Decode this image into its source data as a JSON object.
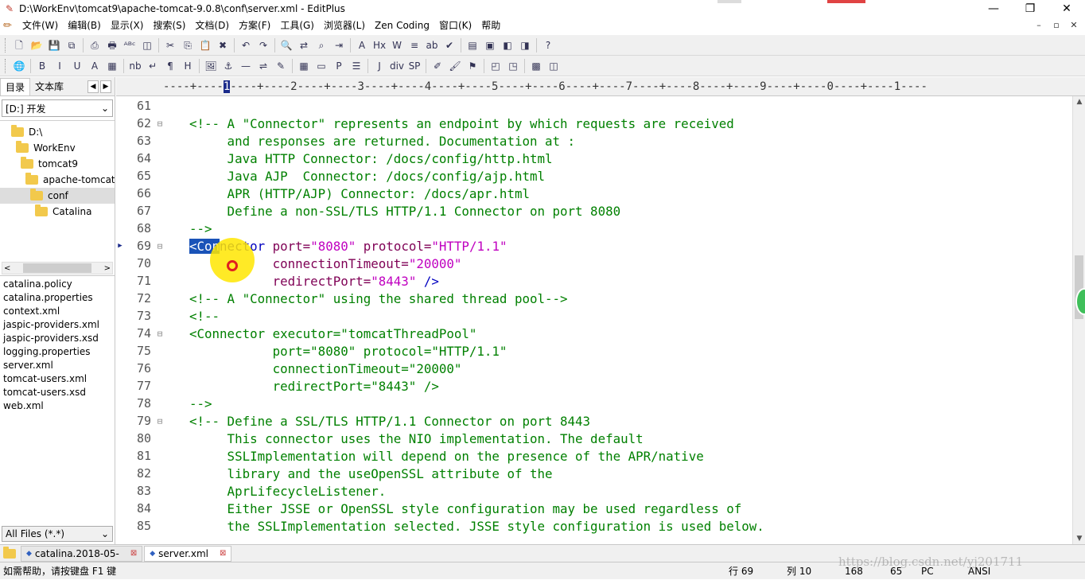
{
  "window": {
    "title": "D:\\WorkEnv\\tomcat9\\apache-tomcat-9.0.8\\conf\\server.xml - EditPlus",
    "minimize": "—",
    "restore": "❐",
    "close": "✕"
  },
  "menu": [
    "文件(W)",
    "编辑(B)",
    "显示(X)",
    "搜索(S)",
    "文档(D)",
    "方案(F)",
    "工具(G)",
    "浏览器(L)",
    "Zen Coding",
    "窗口(K)",
    "帮助"
  ],
  "mdi_buttons": [
    "–",
    "▫",
    "✕"
  ],
  "toolbar1": [
    {
      "name": "new-file-icon",
      "glyph": "🗋"
    },
    {
      "name": "open-folder-icon",
      "glyph": "📂"
    },
    {
      "name": "save-icon",
      "glyph": "💾"
    },
    {
      "name": "save-all-icon",
      "glyph": "⧉"
    },
    {
      "sep": true
    },
    {
      "name": "print-preview-icon",
      "glyph": "⎙"
    },
    {
      "name": "print-icon",
      "glyph": "🖶"
    },
    {
      "name": "spellcheck-icon",
      "glyph": "ᴬᴮᶜ"
    },
    {
      "name": "browser-preview-icon",
      "glyph": "◫"
    },
    {
      "sep": true
    },
    {
      "name": "cut-icon",
      "glyph": "✂"
    },
    {
      "name": "copy-icon",
      "glyph": "⎘"
    },
    {
      "name": "paste-icon",
      "glyph": "📋"
    },
    {
      "name": "delete-icon",
      "glyph": "✖"
    },
    {
      "sep": true
    },
    {
      "name": "undo-icon",
      "glyph": "↶"
    },
    {
      "name": "redo-icon",
      "glyph": "↷"
    },
    {
      "sep": true
    },
    {
      "name": "find-icon",
      "glyph": "🔍"
    },
    {
      "name": "replace-icon",
      "glyph": "⇄"
    },
    {
      "name": "find-in-files-icon",
      "glyph": "⌕"
    },
    {
      "name": "goto-icon",
      "glyph": "⇥"
    },
    {
      "sep": true
    },
    {
      "name": "font-icon",
      "glyph": "A"
    },
    {
      "name": "hex-icon",
      "glyph": "Hx"
    },
    {
      "name": "word-wrap-icon",
      "glyph": "W"
    },
    {
      "name": "line-number-icon",
      "glyph": "≡"
    },
    {
      "name": "ruler-icon",
      "glyph": "ab"
    },
    {
      "name": "check-icon",
      "glyph": "✔"
    },
    {
      "sep": true
    },
    {
      "name": "window-list-icon",
      "glyph": "▤"
    },
    {
      "name": "directory-window-icon",
      "glyph": "▣"
    },
    {
      "name": "cliptext-window-icon",
      "glyph": "◧"
    },
    {
      "name": "output-window-icon",
      "glyph": "◨"
    },
    {
      "sep": true
    },
    {
      "name": "help-icon",
      "glyph": "?"
    }
  ],
  "toolbar2": [
    {
      "name": "globe-icon",
      "glyph": "🌐"
    },
    {
      "sep": true
    },
    {
      "name": "bold-icon",
      "glyph": "B"
    },
    {
      "name": "italic-icon",
      "glyph": "I"
    },
    {
      "name": "underline-icon",
      "glyph": "U"
    },
    {
      "name": "font-color-icon",
      "glyph": "A"
    },
    {
      "name": "color-picker-icon",
      "glyph": "▦"
    },
    {
      "sep": true
    },
    {
      "name": "nbsp-icon",
      "glyph": "nb"
    },
    {
      "name": "line-break-icon",
      "glyph": "↵"
    },
    {
      "name": "paragraph-icon",
      "glyph": "¶"
    },
    {
      "name": "heading-icon",
      "glyph": "H"
    },
    {
      "sep": true
    },
    {
      "name": "image-icon",
      "glyph": "🖼"
    },
    {
      "name": "anchor-icon",
      "glyph": "⚓"
    },
    {
      "name": "horizontal-rule-icon",
      "glyph": "—"
    },
    {
      "name": "link-icon",
      "glyph": "⇌"
    },
    {
      "name": "comment-icon",
      "glyph": "✎"
    },
    {
      "sep": true
    },
    {
      "name": "table-icon",
      "glyph": "▦"
    },
    {
      "name": "form-icon",
      "glyph": "▭"
    },
    {
      "name": "preformatted-icon",
      "glyph": "P"
    },
    {
      "name": "list-icon",
      "glyph": "☰"
    },
    {
      "sep": true
    },
    {
      "name": "script-icon",
      "glyph": "J"
    },
    {
      "name": "div-icon",
      "glyph": "div"
    },
    {
      "name": "span-icon",
      "glyph": "SP"
    },
    {
      "sep": true
    },
    {
      "name": "edit-tag-icon",
      "glyph": "✐"
    },
    {
      "name": "style-icon",
      "glyph": "🖌"
    },
    {
      "name": "quick-tag-icon",
      "glyph": "⚑"
    },
    {
      "sep": true
    },
    {
      "name": "html-toolbar-icon",
      "glyph": "◰"
    },
    {
      "name": "css-toolbar-icon",
      "glyph": "◳"
    },
    {
      "sep": true
    },
    {
      "name": "ie-preview-icon",
      "glyph": "▩"
    },
    {
      "name": "panel-icon",
      "glyph": "◫"
    }
  ],
  "left_panel": {
    "tabs": [
      "目录",
      "文本库"
    ],
    "arrows": [
      "◀",
      "▶"
    ],
    "drive": "[D:] 开发",
    "tree": [
      {
        "label": "D:\\",
        "indent": 0,
        "selected": false
      },
      {
        "label": "WorkEnv",
        "indent": 1,
        "selected": false
      },
      {
        "label": "tomcat9",
        "indent": 2,
        "selected": false
      },
      {
        "label": "apache-tomcat",
        "indent": 3,
        "selected": false
      },
      {
        "label": "conf",
        "indent": 4,
        "selected": true
      },
      {
        "label": "Catalina",
        "indent": 5,
        "selected": false
      }
    ],
    "scroll_left": "<",
    "scroll_right": ">",
    "files": [
      "catalina.policy",
      "catalina.properties",
      "context.xml",
      "jaspic-providers.xml",
      "jaspic-providers.xsd",
      "logging.properties",
      "server.xml",
      "tomcat-users.xml",
      "tomcat-users.xsd",
      "web.xml"
    ],
    "filter": "All Files (*.*)",
    "dropdown_arrow": "⌄"
  },
  "ruler": {
    "before": "----+----",
    "cursor_col": "1",
    "after": "----+----2----+----3----+----4----+----5----+----6----+----7----+----8----+----9----+----0----+----1----"
  },
  "code_lines": [
    {
      "n": "61",
      "fold": "",
      "marker": "",
      "parts": [
        {
          "t": "",
          "c": "c-plain"
        }
      ]
    },
    {
      "n": "62",
      "fold": "⊟",
      "marker": "",
      "parts": [
        {
          "t": "<!-- A \"Connector\" represents an endpoint by which requests are received",
          "c": "c-comment"
        }
      ]
    },
    {
      "n": "63",
      "fold": "",
      "marker": "",
      "parts": [
        {
          "t": "     and responses are returned. Documentation at :",
          "c": "c-comment"
        }
      ]
    },
    {
      "n": "64",
      "fold": "",
      "marker": "",
      "parts": [
        {
          "t": "     Java HTTP Connector: /docs/config/http.html",
          "c": "c-comment"
        }
      ]
    },
    {
      "n": "65",
      "fold": "",
      "marker": "",
      "parts": [
        {
          "t": "     Java AJP  Connector: /docs/config/ajp.html",
          "c": "c-comment"
        }
      ]
    },
    {
      "n": "66",
      "fold": "",
      "marker": "",
      "parts": [
        {
          "t": "     APR (HTTP/AJP) Connector: /docs/apr.html",
          "c": "c-comment"
        }
      ]
    },
    {
      "n": "67",
      "fold": "",
      "marker": "",
      "parts": [
        {
          "t": "     Define a non-SSL/TLS HTTP/1.1 Connector on port 8080",
          "c": "c-comment"
        }
      ]
    },
    {
      "n": "68",
      "fold": "",
      "marker": "",
      "parts": [
        {
          "t": "-->",
          "c": "c-comment"
        }
      ]
    },
    {
      "n": "69",
      "fold": "⊟",
      "marker": "▶",
      "parts": [
        {
          "t": "<Con",
          "c": "sel"
        },
        {
          "t": "nector",
          "c": "c-tag"
        },
        {
          "t": " port=",
          "c": "c-attr"
        },
        {
          "t": "\"8080\"",
          "c": "c-val"
        },
        {
          "t": " protocol=",
          "c": "c-attr"
        },
        {
          "t": "\"HTTP/1.1\"",
          "c": "c-val"
        }
      ]
    },
    {
      "n": "70",
      "fold": "",
      "marker": "",
      "parts": [
        {
          "t": "           connectionTimeout=",
          "c": "c-attr"
        },
        {
          "t": "\"20000\"",
          "c": "c-val"
        }
      ]
    },
    {
      "n": "71",
      "fold": "",
      "marker": "",
      "parts": [
        {
          "t": "           redirectPort=",
          "c": "c-attr"
        },
        {
          "t": "\"8443\"",
          "c": "c-val"
        },
        {
          "t": " />",
          "c": "c-tag"
        }
      ]
    },
    {
      "n": "72",
      "fold": "",
      "marker": "",
      "parts": [
        {
          "t": "<!-- A \"Connector\" using the shared thread pool-->",
          "c": "c-comment"
        }
      ]
    },
    {
      "n": "73",
      "fold": "",
      "marker": "",
      "parts": [
        {
          "t": "<!--",
          "c": "c-comment"
        }
      ]
    },
    {
      "n": "74",
      "fold": "⊟",
      "marker": "",
      "parts": [
        {
          "t": "<Connector executor=\"tomcatThreadPool\"",
          "c": "c-comment"
        }
      ]
    },
    {
      "n": "75",
      "fold": "",
      "marker": "",
      "parts": [
        {
          "t": "           port=\"8080\" protocol=\"HTTP/1.1\"",
          "c": "c-comment"
        }
      ]
    },
    {
      "n": "76",
      "fold": "",
      "marker": "",
      "parts": [
        {
          "t": "           connectionTimeout=\"20000\"",
          "c": "c-comment"
        }
      ]
    },
    {
      "n": "77",
      "fold": "",
      "marker": "",
      "parts": [
        {
          "t": "           redirectPort=\"8443\" />",
          "c": "c-comment"
        }
      ]
    },
    {
      "n": "78",
      "fold": "",
      "marker": "",
      "parts": [
        {
          "t": "-->",
          "c": "c-comment"
        }
      ]
    },
    {
      "n": "79",
      "fold": "⊟",
      "marker": "",
      "parts": [
        {
          "t": "<!-- Define a SSL/TLS HTTP/1.1 Connector on port 8443",
          "c": "c-comment"
        }
      ]
    },
    {
      "n": "80",
      "fold": "",
      "marker": "",
      "parts": [
        {
          "t": "     This connector uses the NIO implementation. The default",
          "c": "c-comment"
        }
      ]
    },
    {
      "n": "81",
      "fold": "",
      "marker": "",
      "parts": [
        {
          "t": "     SSLImplementation will depend on the presence of the APR/native",
          "c": "c-comment"
        }
      ]
    },
    {
      "n": "82",
      "fold": "",
      "marker": "",
      "parts": [
        {
          "t": "     library and the useOpenSSL attribute of the",
          "c": "c-comment"
        }
      ]
    },
    {
      "n": "83",
      "fold": "",
      "marker": "",
      "parts": [
        {
          "t": "     AprLifecycleListener.",
          "c": "c-comment"
        }
      ]
    },
    {
      "n": "84",
      "fold": "",
      "marker": "",
      "parts": [
        {
          "t": "     Either JSSE or OpenSSL style configuration may be used regardless of",
          "c": "c-comment"
        }
      ]
    },
    {
      "n": "85",
      "fold": "",
      "marker": "",
      "parts": [
        {
          "t": "     the SSLImplementation selected. JSSE style configuration is used below.",
          "c": "c-comment"
        }
      ]
    }
  ],
  "doc_tabs": [
    {
      "label": "catalina.2018-05-",
      "active": false,
      "close": "⊠"
    },
    {
      "label": "server.xml",
      "active": true,
      "close": "⊠"
    }
  ],
  "status": {
    "hint": "如需帮助，请按键盘 F1 键",
    "row": "行 69",
    "col": "列 10",
    "total": "168",
    "chars": "65",
    "mode": "PC",
    "encoding": "ANSI"
  },
  "watermark": "https://blog.csdn.net/yj201711",
  "colors": {
    "comment": "#008000",
    "attribute": "#7f0055",
    "value": "#c000c0",
    "selection": "#1a53b8",
    "cursor_halo": "#ffe600"
  }
}
